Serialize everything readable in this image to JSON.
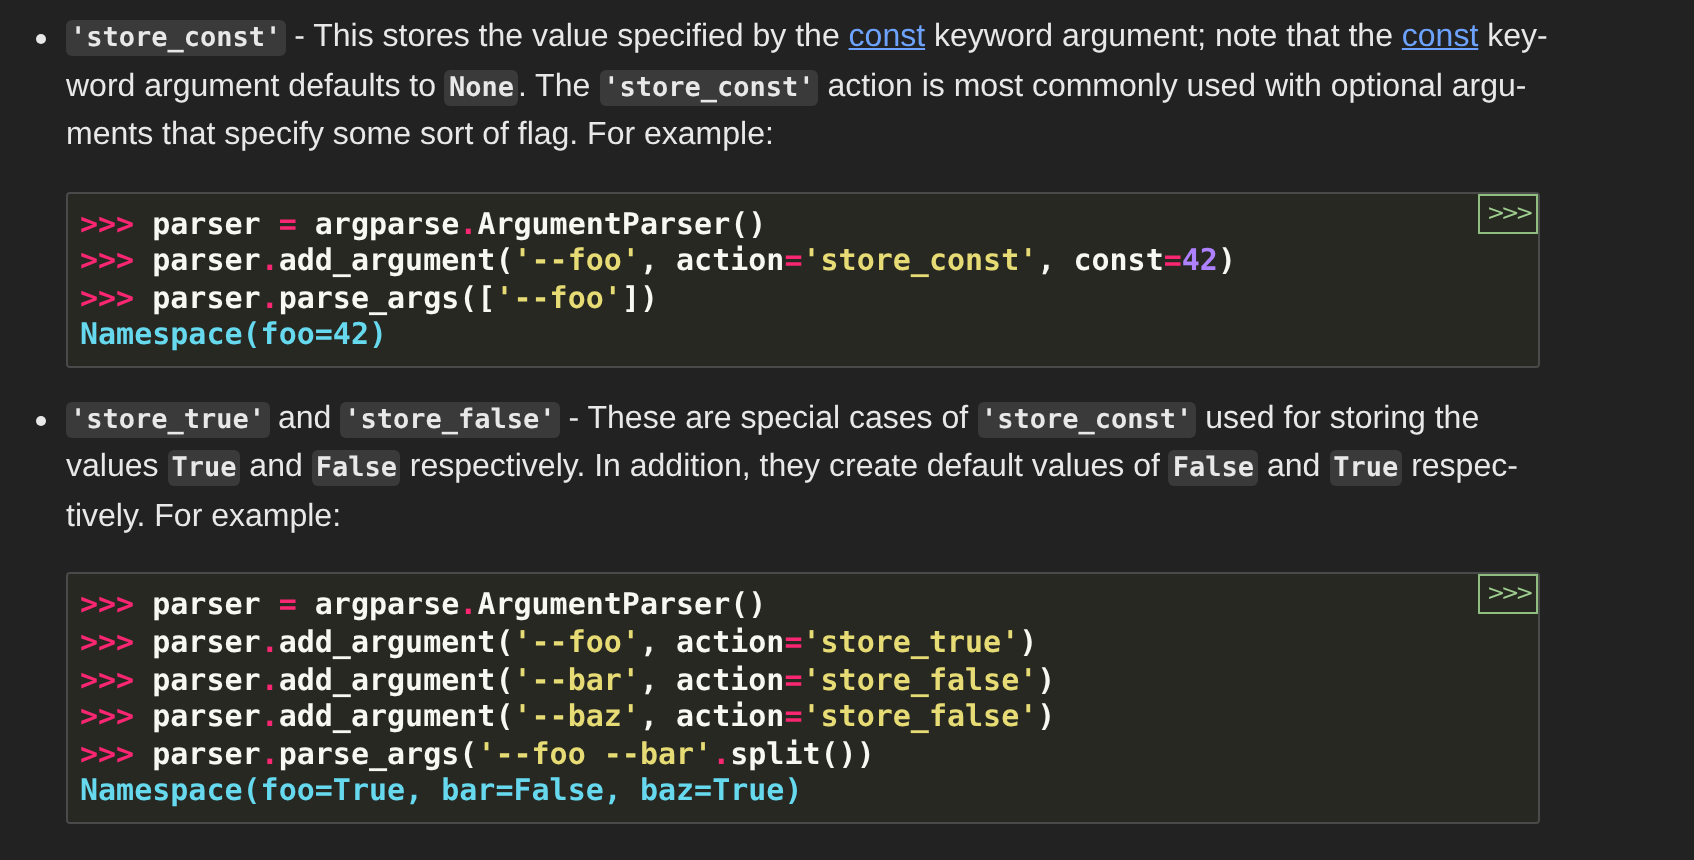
{
  "items": [
    {
      "paragraph": [
        [
          {
            "kind": "code",
            "text": "'store_const'"
          },
          {
            "kind": "text",
            "text": " - This stores the value specified by the "
          },
          {
            "kind": "link",
            "text": "const"
          },
          {
            "kind": "text",
            "text": " keyword argument; note that the "
          },
          {
            "kind": "link",
            "text": "const"
          },
          {
            "kind": "text",
            "text": " key-"
          }
        ],
        [
          {
            "kind": "text",
            "text": "word argument defaults to "
          },
          {
            "kind": "code",
            "text": "None"
          },
          {
            "kind": "text",
            "text": ". The "
          },
          {
            "kind": "code",
            "text": "'store_const'"
          },
          {
            "kind": "text",
            "text": " action is most commonly used with optional argu-"
          }
        ],
        [
          {
            "kind": "text",
            "text": "ments that specify some sort of flag. For example:"
          }
        ]
      ],
      "code": {
        "copy_button": ">>>",
        "lines": [
          [
            {
              "kind": "prompt",
              "text": ">>> "
            },
            {
              "kind": "name",
              "text": "parser "
            },
            {
              "kind": "op",
              "text": "="
            },
            {
              "kind": "name",
              "text": " argparse"
            },
            {
              "kind": "op",
              "text": "."
            },
            {
              "kind": "name",
              "text": "ArgumentParser()"
            }
          ],
          [
            {
              "kind": "prompt",
              "text": ">>> "
            },
            {
              "kind": "name",
              "text": "parser"
            },
            {
              "kind": "op",
              "text": "."
            },
            {
              "kind": "name",
              "text": "add_argument("
            },
            {
              "kind": "str",
              "text": "'--foo'"
            },
            {
              "kind": "name",
              "text": ", action"
            },
            {
              "kind": "op",
              "text": "="
            },
            {
              "kind": "str",
              "text": "'store_const'"
            },
            {
              "kind": "name",
              "text": ", const"
            },
            {
              "kind": "op",
              "text": "="
            },
            {
              "kind": "num",
              "text": "42"
            },
            {
              "kind": "name",
              "text": ")"
            }
          ],
          [
            {
              "kind": "prompt",
              "text": ">>> "
            },
            {
              "kind": "name",
              "text": "parser"
            },
            {
              "kind": "op",
              "text": "."
            },
            {
              "kind": "name",
              "text": "parse_args(["
            },
            {
              "kind": "str",
              "text": "'--foo'"
            },
            {
              "kind": "name",
              "text": "])"
            }
          ],
          [
            {
              "kind": "out",
              "text": "Namespace(foo=42)"
            }
          ]
        ]
      }
    },
    {
      "paragraph": [
        [
          {
            "kind": "code",
            "text": "'store_true'"
          },
          {
            "kind": "text",
            "text": " and "
          },
          {
            "kind": "code",
            "text": "'store_false'"
          },
          {
            "kind": "text",
            "text": " - These are special cases of "
          },
          {
            "kind": "code",
            "text": "'store_const'"
          },
          {
            "kind": "text",
            "text": " used for storing the"
          }
        ],
        [
          {
            "kind": "text",
            "text": "values "
          },
          {
            "kind": "code",
            "text": "True"
          },
          {
            "kind": "text",
            "text": " and "
          },
          {
            "kind": "code",
            "text": "False"
          },
          {
            "kind": "text",
            "text": " respectively. In addition, they create default values of "
          },
          {
            "kind": "code",
            "text": "False"
          },
          {
            "kind": "text",
            "text": " and "
          },
          {
            "kind": "code",
            "text": "True"
          },
          {
            "kind": "text",
            "text": " respec-"
          }
        ],
        [
          {
            "kind": "text",
            "text": "tively. For example:"
          }
        ]
      ],
      "code": {
        "copy_button": ">>>",
        "lines": [
          [
            {
              "kind": "prompt",
              "text": ">>> "
            },
            {
              "kind": "name",
              "text": "parser "
            },
            {
              "kind": "op",
              "text": "="
            },
            {
              "kind": "name",
              "text": " argparse"
            },
            {
              "kind": "op",
              "text": "."
            },
            {
              "kind": "name",
              "text": "ArgumentParser()"
            }
          ],
          [
            {
              "kind": "prompt",
              "text": ">>> "
            },
            {
              "kind": "name",
              "text": "parser"
            },
            {
              "kind": "op",
              "text": "."
            },
            {
              "kind": "name",
              "text": "add_argument("
            },
            {
              "kind": "str",
              "text": "'--foo'"
            },
            {
              "kind": "name",
              "text": ", action"
            },
            {
              "kind": "op",
              "text": "="
            },
            {
              "kind": "str",
              "text": "'store_true'"
            },
            {
              "kind": "name",
              "text": ")"
            }
          ],
          [
            {
              "kind": "prompt",
              "text": ">>> "
            },
            {
              "kind": "name",
              "text": "parser"
            },
            {
              "kind": "op",
              "text": "."
            },
            {
              "kind": "name",
              "text": "add_argument("
            },
            {
              "kind": "str",
              "text": "'--bar'"
            },
            {
              "kind": "name",
              "text": ", action"
            },
            {
              "kind": "op",
              "text": "="
            },
            {
              "kind": "str",
              "text": "'store_false'"
            },
            {
              "kind": "name",
              "text": ")"
            }
          ],
          [
            {
              "kind": "prompt",
              "text": ">>> "
            },
            {
              "kind": "name",
              "text": "parser"
            },
            {
              "kind": "op",
              "text": "."
            },
            {
              "kind": "name",
              "text": "add_argument("
            },
            {
              "kind": "str",
              "text": "'--baz'"
            },
            {
              "kind": "name",
              "text": ", action"
            },
            {
              "kind": "op",
              "text": "="
            },
            {
              "kind": "str",
              "text": "'store_false'"
            },
            {
              "kind": "name",
              "text": ")"
            }
          ],
          [
            {
              "kind": "prompt",
              "text": ">>> "
            },
            {
              "kind": "name",
              "text": "parser"
            },
            {
              "kind": "op",
              "text": "."
            },
            {
              "kind": "name",
              "text": "parse_args("
            },
            {
              "kind": "str",
              "text": "'--foo --bar'"
            },
            {
              "kind": "op",
              "text": "."
            },
            {
              "kind": "name",
              "text": "split())"
            }
          ],
          [
            {
              "kind": "out",
              "text": "Namespace(foo=True, bar=False, baz=True)"
            }
          ]
        ]
      }
    }
  ]
}
